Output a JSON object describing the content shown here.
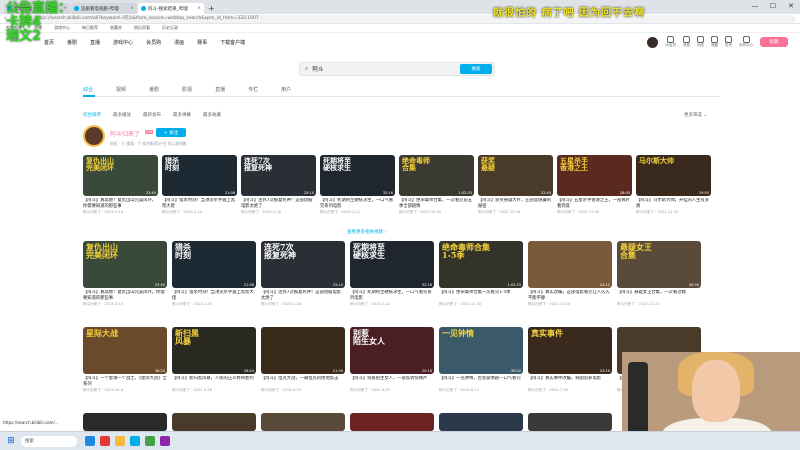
{
  "browser": {
    "tabs": [
      {
        "label": "哔哩哔哩 (゜-゜)つ",
        "active": false
      },
      {
        "label": "追剧看电视剧-哔哩",
        "active": false
      },
      {
        "label": "阿斗-搜索结果_哔哩",
        "active": true
      }
    ],
    "new_tab": "+",
    "url": "https://search.bilibili.com/all?keyword=阿斗&from_source=webtop_search&spm_id_from=333.1007",
    "bookmarks": [
      "哔哩哔哩",
      "直播",
      "游戏中心",
      "每日推荐",
      "收藏夹",
      "稍后再看",
      "历史记录"
    ],
    "status_url": "https://search.bilibili.com/...",
    "window_controls": [
      "—",
      "☐",
      "✕"
    ]
  },
  "header": {
    "nav": [
      "首页",
      "番剧",
      "直播",
      "游戏中心",
      "会员购",
      "漫画",
      "赛事",
      "下载客户端"
    ],
    "icons": [
      {
        "label": "大会员",
        "icon": "vip-icon"
      },
      {
        "label": "消息",
        "icon": "message-icon"
      },
      {
        "label": "动态",
        "icon": "dynamic-icon"
      },
      {
        "label": "收藏",
        "icon": "favorite-icon"
      },
      {
        "label": "历史",
        "icon": "history-icon"
      },
      {
        "label": "创作中心",
        "icon": "creator-icon"
      }
    ],
    "upload": "投稿"
  },
  "search": {
    "query": "阿斗",
    "button": "搜索"
  },
  "categories": [
    {
      "label": "综合",
      "active": true
    },
    {
      "label": "视频",
      "active": false
    },
    {
      "label": "番剧",
      "active": false
    },
    {
      "label": "影视",
      "active": false
    },
    {
      "label": "直播",
      "active": false
    },
    {
      "label": "专栏",
      "active": false
    },
    {
      "label": "用户",
      "active": false
    }
  ],
  "sorts": [
    {
      "label": "综合排序",
      "active": true
    },
    {
      "label": "最多播放",
      "active": false
    },
    {
      "label": "最新发布",
      "active": false
    },
    {
      "label": "最多弹幕",
      "active": false
    },
    {
      "label": "最多收藏",
      "active": false
    }
  ],
  "sort_right": "更多筛选 ⌄",
  "uploader": {
    "name": "阿斗归来了",
    "level": "LV6",
    "follow": "+ 关注",
    "meta": "粉丝 · 万  视频 · 个  知名影视UP主  阿斗说电影"
  },
  "row1": [
    {
      "title": "【阿斗】真高燃！复仇出山完美闭环，你需要知道的那些事",
      "meta": "阿斗归来了 · 2023-3-15",
      "thumb": "复仇出山\n完美闭环",
      "color": "#3a4a3a",
      "text": "#f6d23a",
      "dur": "23:45"
    },
    {
      "title": "【阿斗】猎杀时刻！当顶尖杀手遇上黑帮大佬",
      "meta": "阿斗归来了 · 2023-2-20",
      "thumb": "猎杀\n时刻",
      "color": "#1e2a33",
      "text": "#ffffff",
      "dur": "21:08"
    },
    {
      "title": "【阿斗】连死7次报复死神！这部烧脑电影太绝了",
      "meta": "阿斗归来了 · 2023-1-28",
      "thumb": "连死7次\n报复死神",
      "color": "#2a2f35",
      "text": "#ffffff",
      "dur": "25:10"
    },
    {
      "title": "【阿斗】死期将至硬核求生，一口气看完系列电影",
      "meta": "阿斗归来了 · 2023-1-12",
      "thumb": "死期将至\n硬核求生",
      "color": "#20262e",
      "text": "#ffffff",
      "dur": "32:16"
    },
    {
      "title": "【阿斗】绝命毒师合集，一次看完前五季全部剧情",
      "meta": "阿斗归来了 · 2022-12-30",
      "thumb": "绝命毒师\n合集",
      "color": "#3a3a32",
      "text": "#f6d23a",
      "dur": "1:02:33"
    },
    {
      "title": "【阿斗】获奖悬疑大片，庄园里隐藏的秘密",
      "meta": "阿斗归来了 · 2022-12-18",
      "thumb": "获奖\n悬疑",
      "color": "#4a3a2a",
      "text": "#f6d23a",
      "dur": "22:40"
    },
    {
      "title": "【阿斗】五星杀手香港之王，一部爽片看到底",
      "meta": "阿斗归来了 · 2022-11-30",
      "thumb": "五星杀手\n香港之王",
      "color": "#5a2a1e",
      "text": "#f6d23a",
      "dur": "28:05"
    },
    {
      "title": "【阿斗】马尔斯大帅，开挂的人生有多爽",
      "meta": "阿斗归来了 · 2022-11-15",
      "thumb": "马尔斯大帅",
      "color": "#3a2a1e",
      "text": "#f6d23a",
      "dur": "19:55"
    }
  ],
  "more_label": "查看更多相关视频 ›",
  "row2": [
    {
      "title": "【阿斗】真高燃！复仇出山完美闭环，你需要知道的那些事",
      "meta": "阿斗归来了 · 2023-3-15",
      "thumb": "复仇出山\n完美闭环",
      "color": "#3a4a3a",
      "text": "#f6d23a",
      "dur": "23:45"
    },
    {
      "title": "【阿斗】猎杀时刻！当顶尖杀手遇上黑帮大佬",
      "meta": "阿斗归来了 · 2023-2-20",
      "thumb": "猎杀\n时刻",
      "color": "#1e2a33",
      "text": "#ffffff",
      "dur": "21:08"
    },
    {
      "title": "【阿斗】连死7次报复死神！这部烧脑电影太绝了",
      "meta": "阿斗归来了 · 2023-1-28",
      "thumb": "连死7次\n报复死神",
      "color": "#2a2f35",
      "text": "#ffffff",
      "dur": "25:10"
    },
    {
      "title": "【阿斗】死期将至硬核求生，一口气看完系列电影",
      "meta": "阿斗归来了 · 2023-1-12",
      "thumb": "死期将至\n硬核求生",
      "color": "#20262e",
      "text": "#ffffff",
      "dur": "32:16"
    },
    {
      "title": "【阿斗】绝命毒师合集一次看完1-5季",
      "meta": "阿斗归来了 · 2022-12-30",
      "thumb": "绝命毒师合集\n1-5季",
      "color": "#33332a",
      "text": "#f6d23a",
      "dur": "1:02:33"
    },
    {
      "title": "【阿斗】真实改编，这部电影看完让人久久不能平静",
      "meta": "阿斗归来了 · 2022-12-10",
      "thumb": "",
      "color": "#7a5a3a",
      "text": "#ffffff",
      "dur": "24:12"
    },
    {
      "title": "【阿斗】悬疑女王合集，一次看过瘾",
      "meta": "阿斗归来了 · 2022-11-22",
      "thumb": "悬疑女王\n合集",
      "color": "#5a4a3a",
      "text": "#f6d23a",
      "dur": "45:30"
    }
  ],
  "row3": [
    {
      "title": "【阿斗】一个星球一个战士，《星际大战》全系列",
      "meta": "阿斗归来了 · 2022-10-8",
      "thumb": "星际大战",
      "color": "#6a4a2a",
      "text": "#f6d23a",
      "dur": "38:20"
    },
    {
      "title": "【阿斗】新扫黑风暴，人民的正义终将胜利",
      "meta": "阿斗归来了 · 2022-9-26",
      "thumb": "新扫黑\n风暴",
      "color": "#2a2a22",
      "text": "#f6d23a",
      "dur": "26:44"
    },
    {
      "title": "【阿斗】坦克大战，一辆坦克的绝地反击",
      "meta": "阿斗归来了 · 2022-9-10",
      "thumb": "",
      "color": "#3a2a1a",
      "text": "#f6d23a",
      "dur": "21:30"
    },
    {
      "title": "【阿斗】别惹陌生女人，一部反转惊悚片",
      "meta": "阿斗归来了 · 2022-8-25",
      "thumb": "别惹\n陌生女人",
      "color": "#4a1e22",
      "text": "#ffffff",
      "dur": "20:18"
    },
    {
      "title": "【阿斗】一见钟情，古装爱情剧一口气看完",
      "meta": "阿斗归来了 · 2022-8-12",
      "thumb": "一见钟情",
      "color": "#3a5a6a",
      "text": "#f6d23a",
      "dur": "30:02"
    },
    {
      "title": "【阿斗】真实事件改编，韩国犯罪电影",
      "meta": "阿斗归来了 · 2022-7-30",
      "thumb": "真实事件",
      "color": "#3a2a1e",
      "text": "#f6d23a",
      "dur": "23:10"
    },
    {
      "title": "【阿斗】猩球崛起全系列，人类的末日",
      "meta": "阿斗归来了 · 2022-7-15",
      "thumb": "",
      "color": "#4a3a2a",
      "text": "#ffffff",
      "dur": "40:05"
    }
  ],
  "row4": [
    {
      "color": "#2a2a2a"
    },
    {
      "color": "#4a3a2a"
    },
    {
      "color": "#5a4a3a"
    },
    {
      "color": "#6a2222"
    },
    {
      "color": "#2a3a4a"
    },
    {
      "color": "#3a3a3a"
    }
  ],
  "overlay_text": "公告直播：\n卡牌4\n瑞文2",
  "danmaku": "就很怕的 病了吧 因为回不去啊",
  "taskbar": {
    "search": "搜索",
    "icons": [
      "#1e88e5",
      "#e53935",
      "#f6b93b",
      "#00aeec",
      "#43a047",
      "#8e24aa"
    ]
  }
}
